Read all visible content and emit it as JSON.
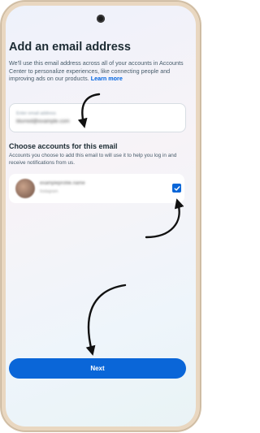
{
  "screen": {
    "title": "Add an email address",
    "description": "We'll use this email address across all of your accounts in Accounts Center to personalize experiences, like connecting people and improving ads on our products.",
    "learn_more": "Learn more"
  },
  "email_field": {
    "placeholder": "Enter email address",
    "value": "blurred@example.com"
  },
  "accounts_section": {
    "title": "Choose accounts for this email",
    "description": "Accounts you choose to add this email to will use it to help you log in and receive notifications from us.",
    "account": {
      "name": "exampleprofile.name",
      "sub": "Instagram",
      "checked": true
    }
  },
  "next_button": {
    "label": "Next"
  },
  "colors": {
    "accent": "#0a66d8",
    "title": "#1c2b33",
    "link": "#0064e0"
  },
  "icons": [
    "camera-icon",
    "checkmark-icon",
    "annotation-arrow-icon"
  ]
}
